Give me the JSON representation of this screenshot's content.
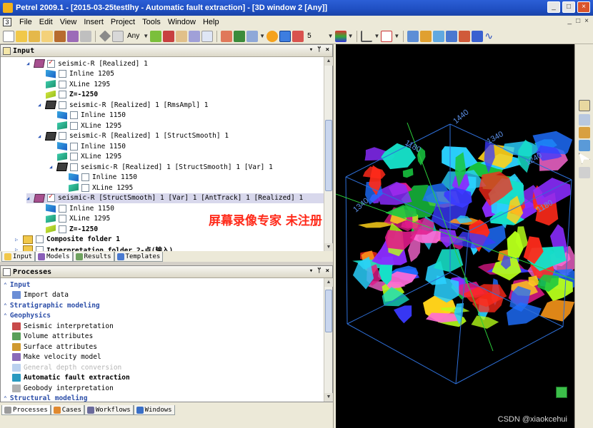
{
  "window": {
    "title": "Petrel 2009.1 - [2015-03-25testlhy - Automatic fault extraction] - [3D window 2 [Any]]",
    "buttons": [
      "_",
      "□",
      "×"
    ]
  },
  "menu": {
    "items": [
      "File",
      "Edit",
      "View",
      "Insert",
      "Project",
      "Tools",
      "Window",
      "Help"
    ],
    "app_icon": "3",
    "mdi_buttons": [
      "_",
      "□",
      "×"
    ]
  },
  "toolbar": {
    "mode_label": "Any",
    "count_label": "5"
  },
  "input_pane": {
    "title": "Input",
    "header_buttons": [
      "▾",
      "ᛘ",
      "×"
    ],
    "items": [
      {
        "label": "seismic-R [Realized] 1",
        "icon": "cube-icon",
        "checked": true,
        "indent": 0
      },
      {
        "label": "Inline 1205",
        "icon": "inline-icon",
        "checked": false,
        "indent": 1
      },
      {
        "label": "XLine 1295",
        "icon": "xline-icon",
        "checked": false,
        "indent": 1
      },
      {
        "label": "Z=-1250",
        "icon": "z-slice-icon",
        "checked": false,
        "indent": 1
      },
      {
        "label": "seismic-R [Realized] 1 [RmsAmpl] 1",
        "icon": "cube-dark-icon",
        "checked": false,
        "indent": 1
      },
      {
        "label": "Inline 1150",
        "icon": "inline-icon",
        "checked": false,
        "indent": 2
      },
      {
        "label": "XLine 1295",
        "icon": "xline-icon",
        "checked": false,
        "indent": 2
      },
      {
        "label": "seismic-R [Realized] 1 [StructSmooth] 1",
        "icon": "cube-dark-icon",
        "checked": false,
        "indent": 1
      },
      {
        "label": "Inline 1150",
        "icon": "inline-icon",
        "checked": false,
        "indent": 2
      },
      {
        "label": "XLine 1295",
        "icon": "xline-icon",
        "checked": false,
        "indent": 2
      },
      {
        "label": "seismic-R [Realized] 1 [StructSmooth] 1 [Var] 1",
        "icon": "cube-dark-icon",
        "checked": false,
        "indent": 2
      },
      {
        "label": "Inline 1150",
        "icon": "inline-icon",
        "checked": false,
        "indent": 3
      },
      {
        "label": "XLine 1295",
        "icon": "xline-icon",
        "checked": false,
        "indent": 3
      },
      {
        "label": "seismic-R [StructSmooth] 1 [Var] 1 [AntTrack] 1 [Realized] 1",
        "icon": "cube-icon",
        "checked": true,
        "indent": 0,
        "selected": true
      },
      {
        "label": "Inline 1150",
        "icon": "inline-icon",
        "checked": false,
        "indent": 1
      },
      {
        "label": "XLine 1295",
        "icon": "xline-icon",
        "checked": false,
        "indent": 1
      },
      {
        "label": "Z=-1250",
        "icon": "z-slice-icon",
        "checked": false,
        "indent": 1
      },
      {
        "label": "Composite folder 1",
        "icon": "folder-icon",
        "checked": false,
        "indent": -1
      },
      {
        "label": "Interpretation folder 2-点(输入)",
        "icon": "folder-icon",
        "checked": false,
        "indent": -1
      }
    ],
    "tabs": [
      "Input",
      "Models",
      "Results",
      "Templates"
    ]
  },
  "processes_pane": {
    "title": "Processes",
    "header_buttons": [
      "▾",
      "ᛘ",
      "×"
    ],
    "items": [
      {
        "label": "Input",
        "type": "group"
      },
      {
        "label": "Import data",
        "type": "item"
      },
      {
        "label": "Stratigraphic modeling",
        "type": "group"
      },
      {
        "label": "Geophysics",
        "type": "group"
      },
      {
        "label": "Seismic interpretation",
        "type": "item"
      },
      {
        "label": "Volume attributes",
        "type": "item"
      },
      {
        "label": "Surface attributes",
        "type": "item"
      },
      {
        "label": "Make velocity model",
        "type": "item"
      },
      {
        "label": "General depth conversion",
        "type": "disabled"
      },
      {
        "label": "Automatic fault extraction",
        "type": "bold"
      },
      {
        "label": "Geobody interpretation",
        "type": "item"
      },
      {
        "label": "Structural modeling",
        "type": "group"
      }
    ],
    "tabs": [
      "Processes",
      "Cases",
      "Workflows",
      "Windows"
    ]
  },
  "view3d": {
    "axis_labels": [
      "1440",
      "1180",
      "1340",
      "1240",
      "1340",
      "1180"
    ],
    "watermark": "屏幕录像专家 未注册",
    "credit": "CSDN @xiaokcehui",
    "colors": {
      "background": "#000000",
      "box": "#2e6fd8",
      "axis_green": "#2bcf3a"
    }
  }
}
